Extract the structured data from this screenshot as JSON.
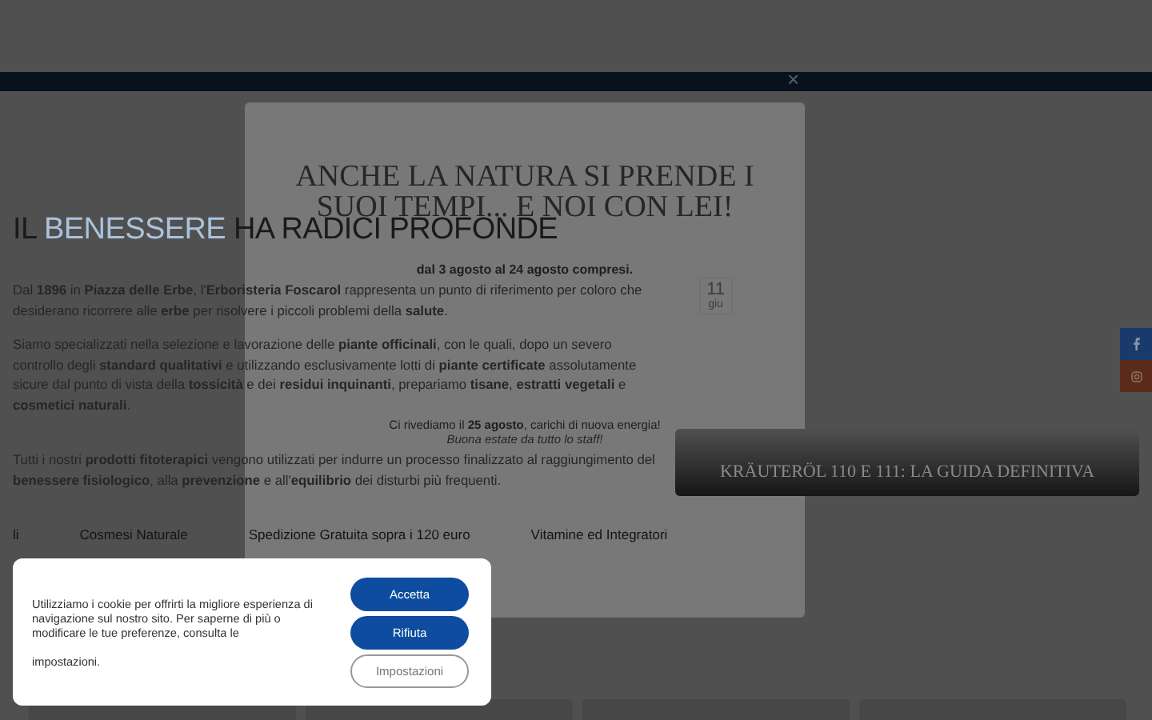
{
  "top_bar": {
    "close": "×"
  },
  "hero": {
    "title_start": "IL",
    "title_highlight": "BENESSERE",
    "title_end": "HA RADICI PROFONDE",
    "paragraphs": [
      "Dal **1896** in **Piazza delle Erbe**, l'**Erboristeria Foscarol** rappresenta un punto di riferimento per coloro che desiderano ricorrere alle **erbe** per risolvere i piccoli problemi della **salute**.",
      "Siamo specializzati nella selezione e lavorazione delle **piante officinali**, con le quali, dopo un severo controllo degli **standard qualitativi** e utilizzando esclusivamente lotti di **piante certificate** assolutamente sicure dal punto di vista della **tossicità** e dei **residui inquinanti**, prepariamo **tisane**, **estratti vegetali** e **cosmetici naturali**.",
      "Tutti i nostri **prodotti fitoterapici** vengono utilizzati per indurre un processo finalizzato al raggiungimento del **benessere fisiologico**, alla **prevenzione** e all'**equilibrio** dei disturbi più frequenti."
    ]
  },
  "article_banner": {
    "title": "KRÄUTERÖL 110 E 111: LA GUIDA DEFINITIVA"
  },
  "category_links": [
    "li",
    "Cosmesi Naturale",
    "Spedizione Gratuita sopra i 120 euro",
    "Vitamine ed Integratori"
  ],
  "social": [
    {
      "kind": "facebook",
      "color": "#1a3a6e"
    },
    {
      "kind": "instagram",
      "color": "#5a2a1a"
    }
  ],
  "popup": {
    "title": "ANCHE LA NATURA SI PRENDE I SUOI TEMPI... E NOI CON LEI!",
    "dates": "dal 3 agosto al 24 agosto compresi.",
    "countdown_number": "11",
    "countdown_unit": "giu",
    "return_note": "Ci rivediamo il **25 agosto**, carichi di nuova energia!",
    "greeting": "Buona estate da tutto lo staff!"
  },
  "cookie_banner": {
    "text": "Utilizziamo i cookie per offrirti la migliore esperienza di navigazione sul nostro sito. Per saperne di più o modificare le tue preferenze, consulta le",
    "link": "impostazioni.",
    "buttons": [
      {
        "label": "Accetta",
        "kind": "primary"
      },
      {
        "label": "Rifiuta",
        "kind": "primary"
      },
      {
        "label": "Impostazioni",
        "kind": "outline"
      }
    ]
  }
}
